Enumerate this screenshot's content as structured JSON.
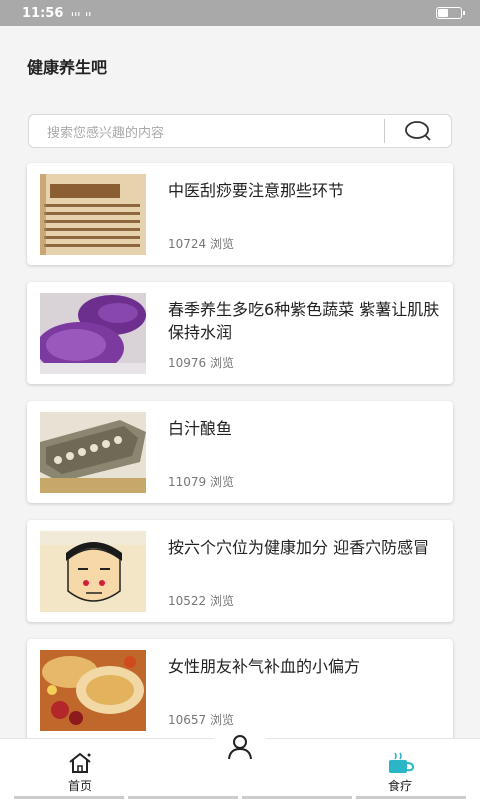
{
  "status_bar": {
    "time": "11:56",
    "signal_text": "ᵢᵢₗ ᵢₗ"
  },
  "header": {
    "title": "健康养生吧"
  },
  "search": {
    "placeholder": "搜索您感兴趣的内容",
    "icon": "search-icon"
  },
  "articles": [
    {
      "title": "中医刮痧要注意那些环节",
      "views": "10724 浏览",
      "thumb": "guasha-book-image"
    },
    {
      "title": "春季养生多吃6种紫色蔬菜 紫薯让肌肤保持水润",
      "views": "10976 浏览",
      "thumb": "purple-sweet-potato-image"
    },
    {
      "title": "白汁酿鱼",
      "views": "11079 浏览",
      "thumb": "stuffed-fish-image"
    },
    {
      "title": "按六个穴位为健康加分 迎香穴防感冒",
      "views": "10522 浏览",
      "thumb": "acupoint-face-image"
    },
    {
      "title": "女性朋友补气补血的小偏方",
      "views": "10657 浏览",
      "thumb": "herbal-tea-image"
    }
  ],
  "bottom_nav": {
    "home_label": "首页",
    "therapy_label": "食疗",
    "accent": "#2bb5c9"
  }
}
